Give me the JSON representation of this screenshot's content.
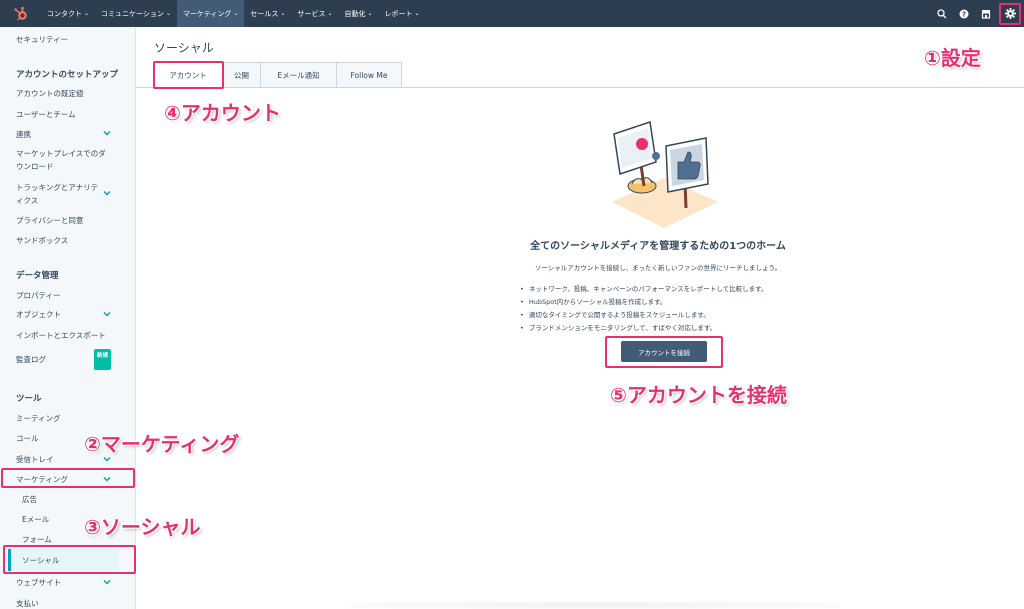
{
  "colors": {
    "nav_bg": "#2d3e50",
    "accent_pink": "#e5316f",
    "teal": "#00a4bd",
    "badge_green": "#00bda5",
    "button_dark": "#425b76"
  },
  "topnav": {
    "items": [
      {
        "label": "コンタクト"
      },
      {
        "label": "コミュニケーション"
      },
      {
        "label": "マーケティング",
        "active": true
      },
      {
        "label": "セールス"
      },
      {
        "label": "サービス"
      },
      {
        "label": "自動化"
      },
      {
        "label": "レポート"
      }
    ],
    "icons": [
      "search-icon",
      "help-icon",
      "marketplace-icon",
      "gear-icon"
    ]
  },
  "sidebar": {
    "security": "セキュリティー",
    "account_setup_heading": "アカウントのセットアップ",
    "account_defaults": "アカウントの既定値",
    "users_teams": "ユーザーとチーム",
    "integrations": "連携",
    "marketplace_downloads": "マーケットプレイスでのダウンロード",
    "tracking_analytics": "トラッキングとアナリティクス",
    "privacy_consent": "プライバシーと同意",
    "sandbox": "サンドボックス",
    "data_mgmt_heading": "データ管理",
    "properties": "プロパティー",
    "objects": "オブジェクト",
    "import_export": "インポートとエクスポート",
    "audit_log": "監査ログ",
    "new_badge": "新規",
    "tools_heading": "ツール",
    "meetings": "ミーティング",
    "calling": "コール",
    "inbox": "受信トレイ",
    "marketing": "マーケティング",
    "ads": "広告",
    "email": "Eメール",
    "forms": "フォーム",
    "social": "ソーシャル",
    "website": "ウェブサイト",
    "payments": "支払い"
  },
  "main": {
    "title": "ソーシャル",
    "tabs": [
      {
        "label": "アカウント"
      },
      {
        "label": "公開"
      },
      {
        "label": "Eメール通知"
      },
      {
        "label": "Follow Me"
      }
    ],
    "empty_title": "全てのソーシャルメディアを管理するための1つのホーム",
    "empty_desc": "ソーシャルアカウントを接続し、まったく新しいファンの世界にリーチしましょう。",
    "bullets": [
      "ネットワーク、投稿、キャンペーンのパフォーマンスをレポートして比較します。",
      "HubSpot内からソーシャル投稿を作成します。",
      "適切なタイミングで公開するよう投稿をスケジュールします。",
      "ブランドメンションをモニタリングして、すばやく対応します。"
    ],
    "connect_button": "アカウントを接続"
  },
  "annotations": {
    "settings": "①設定",
    "marketing": "②マーケティング",
    "social": "③ソーシャル",
    "account": "④アカウント",
    "connect": "⑤アカウントを接続"
  }
}
